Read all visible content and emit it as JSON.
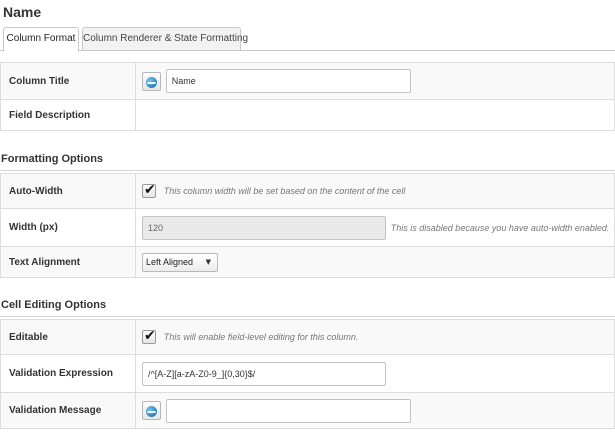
{
  "page": {
    "title": "Name"
  },
  "tabs": [
    {
      "label": "Column Format",
      "active": true
    },
    {
      "label": "Column Renderer & State Formatting",
      "active": false
    }
  ],
  "general": {
    "column_title": {
      "label": "Column Title",
      "value": "Name",
      "icon": "globe-icon"
    },
    "field_description": {
      "label": "Field Description"
    }
  },
  "formatting": {
    "heading": "Formatting Options",
    "auto_width": {
      "label": "Auto-Width",
      "checked": true,
      "hint": "This column width will be set based on the content of the cell"
    },
    "width": {
      "label": "Width (px)",
      "value": "120",
      "disabled": true,
      "hint": "This is disabled because you have auto-width enabled."
    },
    "text_alignment": {
      "label": "Text Alignment",
      "selected": "Left Aligned"
    }
  },
  "cell_editing": {
    "heading": "Cell Editing Options",
    "editable": {
      "label": "Editable",
      "checked": true,
      "hint": "This will enable field-level editing for this column."
    },
    "validation_expression": {
      "label": "Validation Expression",
      "value": "/^[A-Z][a-zA-Z0-9_]{0,30}$/"
    },
    "validation_message": {
      "label": "Validation Message",
      "value": "",
      "icon": "globe-icon"
    }
  }
}
